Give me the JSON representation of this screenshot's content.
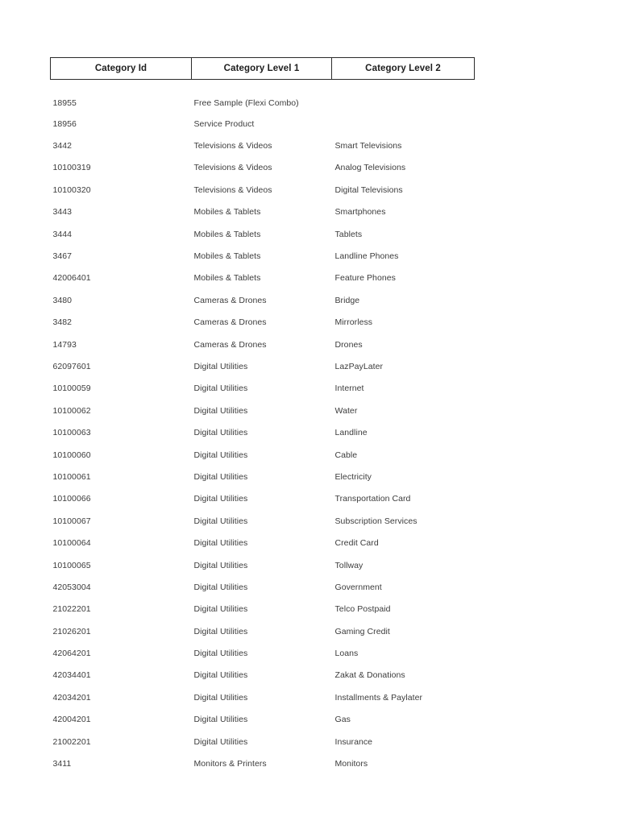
{
  "document": {
    "background_color": "#ffffff",
    "text_color": "#3c3c3c",
    "header_text_color": "#1d1d1d",
    "border_color": "#2b2b2b"
  },
  "table": {
    "name": "category-table",
    "columns": [
      {
        "key": "category_id",
        "label": "Category Id"
      },
      {
        "key": "category_level_1",
        "label": "Category Level 1"
      },
      {
        "key": "category_level_2",
        "label": "Category Level 2"
      }
    ],
    "rows": [
      {
        "category_id": "18955",
        "category_level_1": "Free Sample (Flexi Combo)",
        "category_level_2": ""
      },
      {
        "category_id": "18956",
        "category_level_1": "Service Product",
        "category_level_2": ""
      },
      {
        "category_id": "3442",
        "category_level_1": "Televisions & Videos",
        "category_level_2": "Smart Televisions"
      },
      {
        "category_id": "10100319",
        "category_level_1": "Televisions & Videos",
        "category_level_2": "Analog Televisions"
      },
      {
        "category_id": "10100320",
        "category_level_1": "Televisions & Videos",
        "category_level_2": "Digital Televisions"
      },
      {
        "category_id": "3443",
        "category_level_1": "Mobiles & Tablets",
        "category_level_2": "Smartphones"
      },
      {
        "category_id": "3444",
        "category_level_1": "Mobiles & Tablets",
        "category_level_2": "Tablets"
      },
      {
        "category_id": "3467",
        "category_level_1": "Mobiles & Tablets",
        "category_level_2": "Landline Phones"
      },
      {
        "category_id": "42006401",
        "category_level_1": "Mobiles & Tablets",
        "category_level_2": "Feature Phones"
      },
      {
        "category_id": "3480",
        "category_level_1": "Cameras & Drones",
        "category_level_2": "Bridge"
      },
      {
        "category_id": "3482",
        "category_level_1": "Cameras & Drones",
        "category_level_2": "Mirrorless"
      },
      {
        "category_id": "14793",
        "category_level_1": "Cameras & Drones",
        "category_level_2": "Drones"
      },
      {
        "category_id": "62097601",
        "category_level_1": "Digital Utilities",
        "category_level_2": "LazPayLater"
      },
      {
        "category_id": "10100059",
        "category_level_1": "Digital Utilities",
        "category_level_2": "Internet"
      },
      {
        "category_id": "10100062",
        "category_level_1": "Digital Utilities",
        "category_level_2": "Water"
      },
      {
        "category_id": "10100063",
        "category_level_1": "Digital Utilities",
        "category_level_2": "Landline"
      },
      {
        "category_id": "10100060",
        "category_level_1": "Digital Utilities",
        "category_level_2": "Cable"
      },
      {
        "category_id": "10100061",
        "category_level_1": "Digital Utilities",
        "category_level_2": "Electricity"
      },
      {
        "category_id": "10100066",
        "category_level_1": "Digital Utilities",
        "category_level_2": "Transportation Card"
      },
      {
        "category_id": "10100067",
        "category_level_1": "Digital Utilities",
        "category_level_2": "Subscription Services"
      },
      {
        "category_id": "10100064",
        "category_level_1": "Digital Utilities",
        "category_level_2": "Credit Card"
      },
      {
        "category_id": "10100065",
        "category_level_1": "Digital Utilities",
        "category_level_2": "Tollway"
      },
      {
        "category_id": "42053004",
        "category_level_1": "Digital Utilities",
        "category_level_2": "Government"
      },
      {
        "category_id": "21022201",
        "category_level_1": "Digital Utilities",
        "category_level_2": "Telco Postpaid"
      },
      {
        "category_id": "21026201",
        "category_level_1": "Digital Utilities",
        "category_level_2": "Gaming Credit"
      },
      {
        "category_id": "42064201",
        "category_level_1": "Digital Utilities",
        "category_level_2": "Loans"
      },
      {
        "category_id": "42034401",
        "category_level_1": "Digital Utilities",
        "category_level_2": "Zakat & Donations"
      },
      {
        "category_id": "42034201",
        "category_level_1": "Digital Utilities",
        "category_level_2": "Installments & Paylater"
      },
      {
        "category_id": "42004201",
        "category_level_1": "Digital Utilities",
        "category_level_2": "Gas"
      },
      {
        "category_id": "21002201",
        "category_level_1": "Digital Utilities",
        "category_level_2": "Insurance"
      },
      {
        "category_id": "3411",
        "category_level_1": "Monitors & Printers",
        "category_level_2": "Monitors"
      }
    ]
  }
}
